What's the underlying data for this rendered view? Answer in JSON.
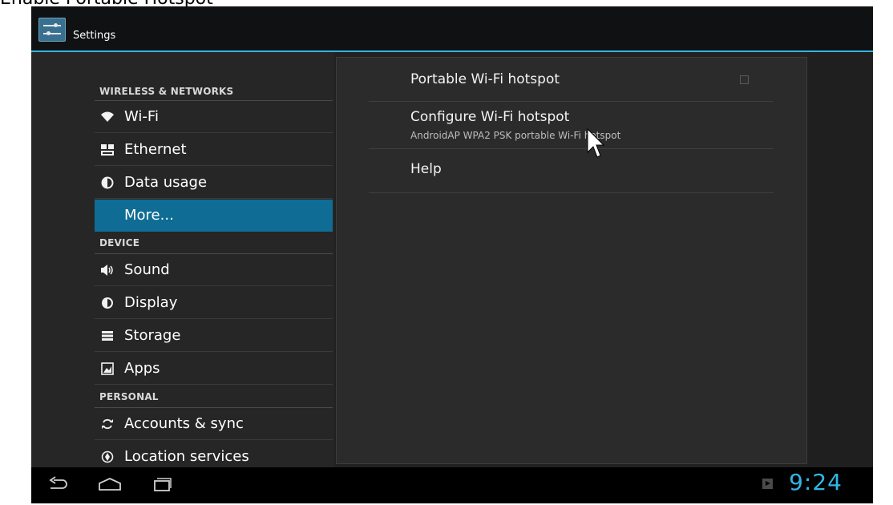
{
  "caption": "Enable Portable Hotspot",
  "app": {
    "title": "Settings",
    "icon": "settings-sliders-icon"
  },
  "sidebar": {
    "categories": [
      "WIRELESS & NETWORKS",
      "DEVICE",
      "PERSONAL"
    ],
    "items": [
      {
        "label": "Wi-Fi",
        "icon": "wifi-icon"
      },
      {
        "label": "Ethernet",
        "icon": "ethernet-icon"
      },
      {
        "label": "Data usage",
        "icon": "data-usage-icon"
      },
      {
        "label": "More...",
        "icon": "",
        "selected": true
      },
      {
        "label": "Sound",
        "icon": "sound-icon"
      },
      {
        "label": "Display",
        "icon": "display-icon"
      },
      {
        "label": "Storage",
        "icon": "storage-icon"
      },
      {
        "label": "Apps",
        "icon": "apps-icon"
      },
      {
        "label": "Accounts & sync",
        "icon": "sync-icon"
      },
      {
        "label": "Location services",
        "icon": "location-icon"
      }
    ]
  },
  "content": {
    "prefs": [
      {
        "title": "Portable Wi-Fi hotspot",
        "summary": "",
        "checked": false
      },
      {
        "title": "Configure Wi-Fi hotspot",
        "summary": "AndroidAP WPA2 PSK portable Wi-Fi hotspot"
      },
      {
        "title": "Help",
        "summary": ""
      }
    ]
  },
  "statusbar": {
    "time": "9:24"
  },
  "colors": {
    "accent": "#33b5e5",
    "selected": "#0f6c94"
  }
}
